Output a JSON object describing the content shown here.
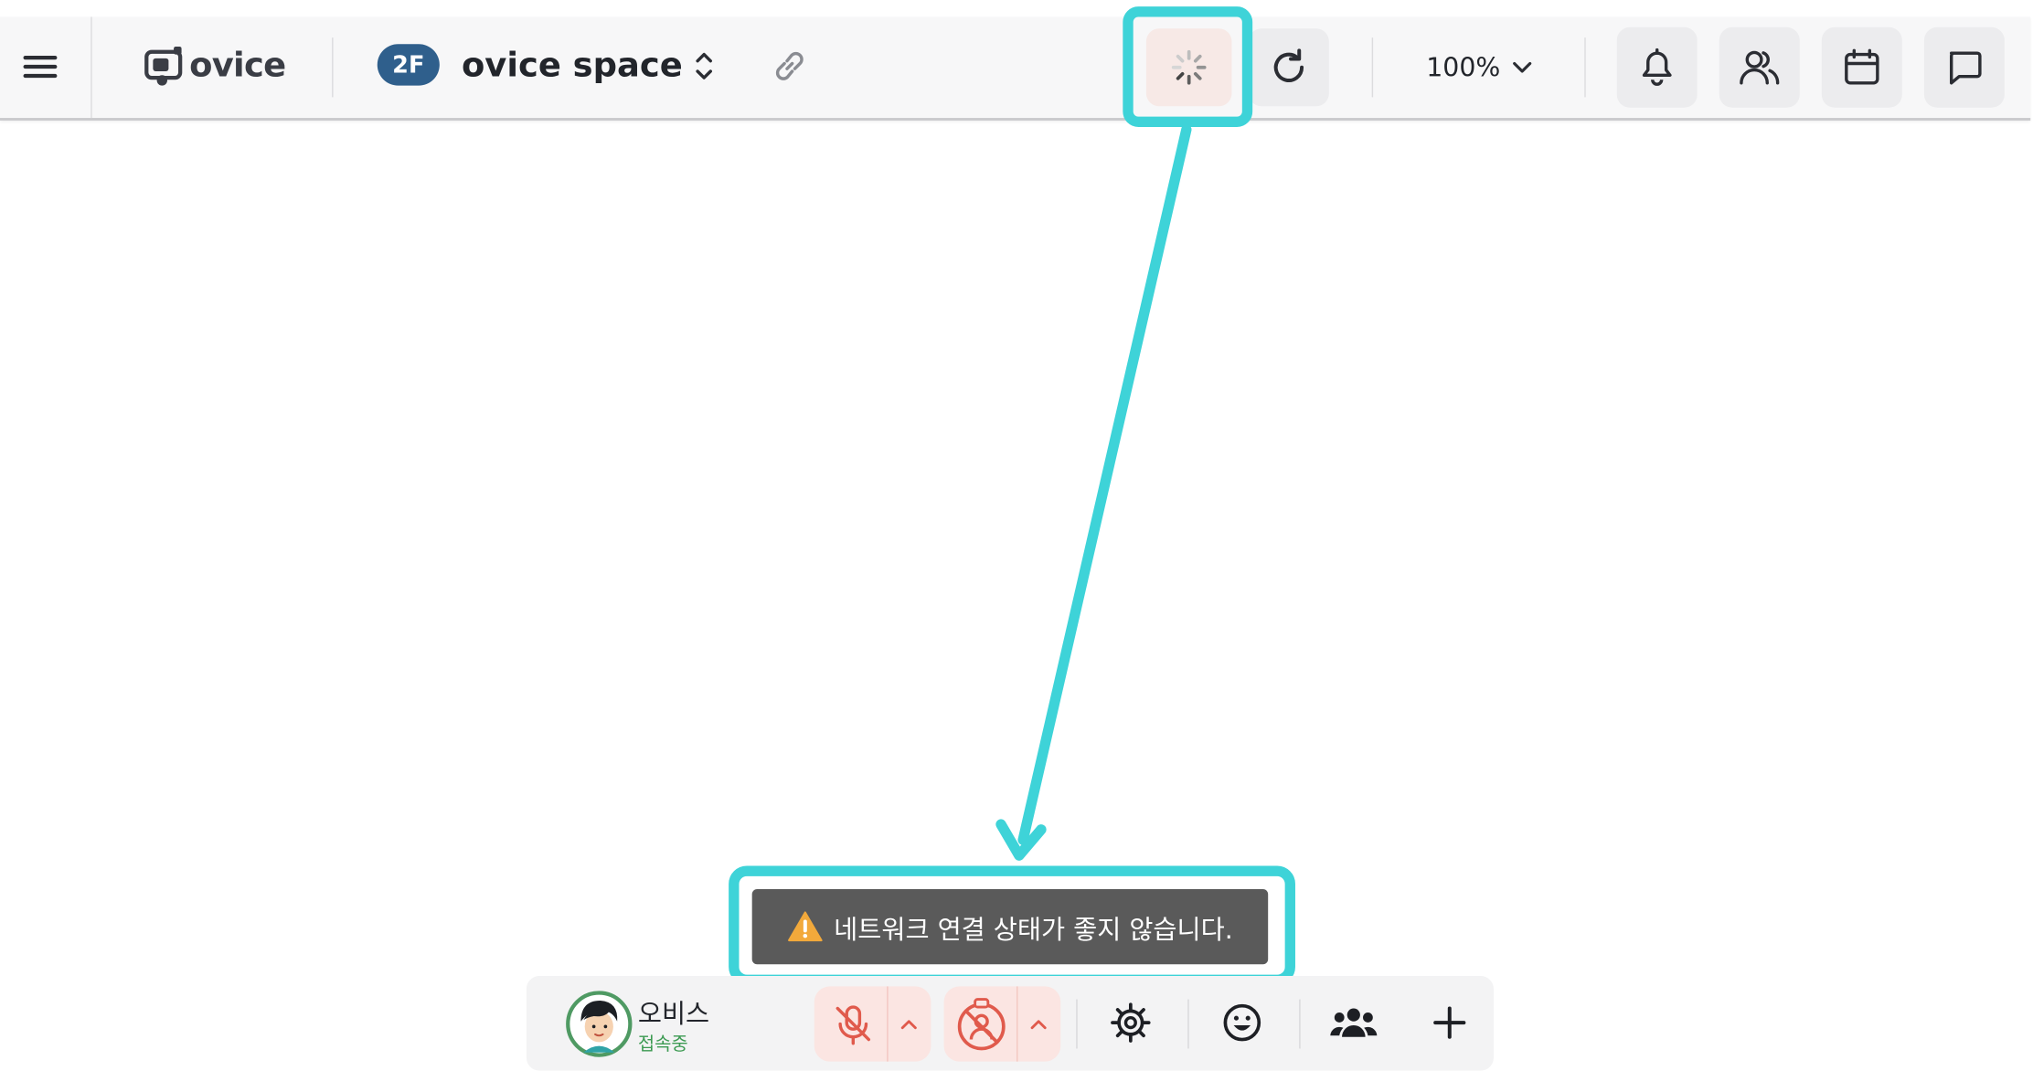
{
  "header": {
    "logo_text": "ovice",
    "floor_badge": "2F",
    "space_name": "ovice space",
    "zoom_level": "100%"
  },
  "toast": {
    "message": "네트워크 연결 상태가 좋지 않습니다."
  },
  "dock": {
    "user_name": "오비스",
    "user_status": "접속중"
  },
  "colors": {
    "highlight": "#3ed3d8",
    "floor_badge": "#2f5f8c",
    "mic_muted_bg": "#fbe5e2",
    "mic_muted_icon": "#e05a4c",
    "status_green": "#3c9a52",
    "toast_bg": "#5a5a5a",
    "warning": "#f2a93b"
  },
  "icons": [
    "hamburger-menu-icon",
    "ovice-logo-icon",
    "chevron-up-down-icon",
    "link-icon",
    "loading-spinner-icon",
    "refresh-icon",
    "chevron-down-icon",
    "bell-icon",
    "people-icon",
    "calendar-icon",
    "chat-icon",
    "warning-icon",
    "avatar",
    "mic-off-icon",
    "camera-off-icon",
    "gear-icon",
    "smile-icon",
    "group-icon",
    "plus-icon"
  ]
}
